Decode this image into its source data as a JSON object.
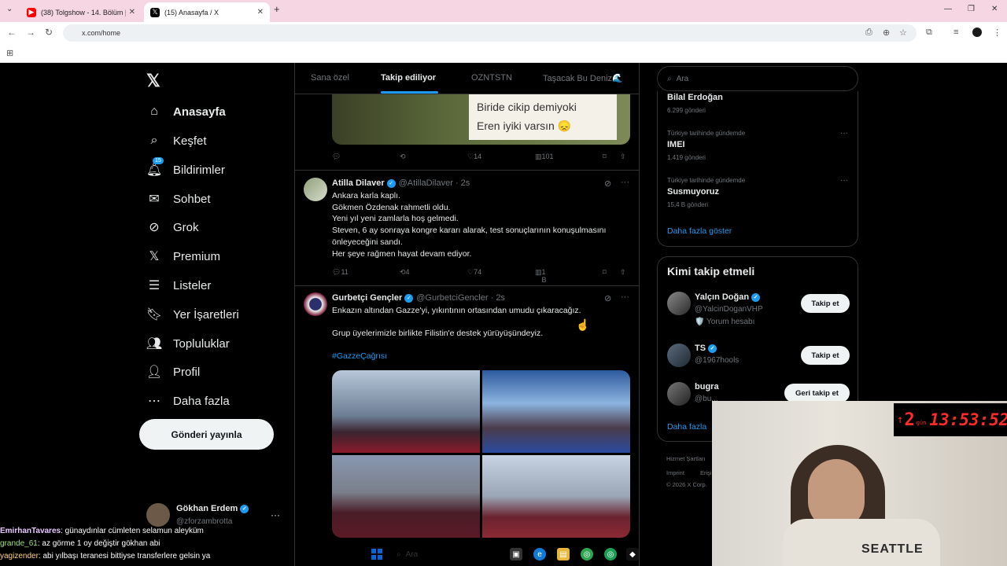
{
  "browser": {
    "tabs": [
      {
        "title": "(38) Tolgshow - 14. Bölüm | Bir..."
      },
      {
        "title": "(15) Anasayfa / X"
      }
    ],
    "url": "x.com/home"
  },
  "nav": {
    "items": [
      {
        "label": "Anasayfa"
      },
      {
        "label": "Keşfet"
      },
      {
        "label": "Bildirimler",
        "badge": "15"
      },
      {
        "label": "Sohbet"
      },
      {
        "label": "Grok"
      },
      {
        "label": "Premium"
      },
      {
        "label": "Listeler"
      },
      {
        "label": "Yer İşaretleri"
      },
      {
        "label": "Topluluklar"
      },
      {
        "label": "Profil"
      },
      {
        "label": "Daha fazla"
      }
    ],
    "post_button": "Gönderi yayınla",
    "profile": {
      "name": "Gökhan Erdem",
      "handle": "@zforzambrotta"
    }
  },
  "feed": {
    "tabs": [
      {
        "label": "Sana özel"
      },
      {
        "label": "Takip ediliyor"
      },
      {
        "label": "OZNTSTN"
      },
      {
        "label": "Taşacak Bu Deniz🌊"
      }
    ],
    "top_image_caption": [
      "Biride cikip demiyoki",
      "Eren iyiki varsın 😞"
    ],
    "top_actions": {
      "likes": "14",
      "views": "101"
    },
    "posts": [
      {
        "name": "Atilla Dilaver",
        "handle": "@AtillaDilaver",
        "time": "· 2s",
        "lines": [
          "Ankara karla kaplı.",
          "Gökmen Özdenak rahmetli oldu.",
          "Yeni yıl yeni zamlarla hoş gelmedi.",
          "Steven, 6 ay sonraya kongre kararı alarak, test sonuçlarının konuşulmasını",
          "önleyeceğini sandı.",
          "Her şeye rağmen hayat devam ediyor."
        ],
        "replies": "11",
        "reposts": "4",
        "likes": "74",
        "views": "1 B"
      },
      {
        "name": "Gurbetçi Gençler",
        "handle": "@GurbetciGencler",
        "time": "· 2s",
        "lines": [
          "Enkazın altından Gazze'yi, yıkıntının ortasından umudu çıkaracağız.",
          "",
          "Grup üyelerimizle birlikte Filistin'e destek yürüyüşündeyiz."
        ],
        "hashtag": "#GazzeÇağrısı"
      }
    ]
  },
  "sidebar": {
    "search_placeholder": "Ara",
    "trends": [
      {
        "category": "",
        "name": "Bilal Erdoğan",
        "count": "6.299 gönderi"
      },
      {
        "category": "Türkiye tarihinde gündemde",
        "name": "IMEI",
        "count": "1.419 gönderi"
      },
      {
        "category": "Türkiye tarihinde gündemde",
        "name": "Susmuyoruz",
        "count": "15,4 B gönderi"
      }
    ],
    "show_more": "Daha fazla göster",
    "who_to_follow": {
      "title": "Kimi takip etmeli",
      "users": [
        {
          "name": "Yalçın Doğan",
          "handle": "@YalcinDoganVHP",
          "note": "🛡️ Yorum hesabı",
          "button": "Takip et"
        },
        {
          "name": "TS",
          "handle": "@1967hools",
          "note": "",
          "button": "Takip et"
        },
        {
          "name": "bugra",
          "handle": "@bu...",
          "note": "",
          "button": "Geri takip et"
        }
      ],
      "more": "Daha fazla"
    },
    "footer": [
      "Hizmet Şartları",
      "Imprint",
      "Erişi...",
      "© 2026 X Corp."
    ]
  },
  "stream_overlay": {
    "timer_arrow": "↑",
    "timer_days": "2",
    "timer_days_label": "gün",
    "timer_clock": "13:53:52",
    "shirt_text": "SEATTLE",
    "chat": [
      {
        "user": "EmirhanTavares",
        "msg": ": günaydınlar cümleten selamun aleyküm"
      },
      {
        "user": "grande_61",
        "msg": ": az görme 1 oy değiştir gökhan abi"
      },
      {
        "user": "yagizender",
        "msg": ": abi yılbaşı teranesi bittiyse transferlere gelsin ya"
      }
    ]
  },
  "taskbar": {
    "search": "Ara"
  }
}
